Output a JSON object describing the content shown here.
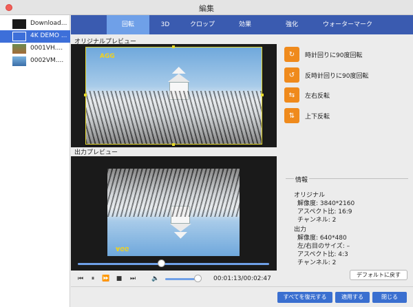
{
  "window": {
    "title": "編集"
  },
  "files": [
    {
      "name": "Download...",
      "thumb": "dark"
    },
    {
      "name": "4K DEMO ...",
      "thumb": "blue",
      "selected": true
    },
    {
      "name": "0001VH....",
      "thumb": "nature"
    },
    {
      "name": "0002VM....",
      "thumb": "sky"
    }
  ],
  "tabs": [
    "回転",
    "3D",
    "クロップ",
    "効果",
    "強化",
    "ウォーターマーク"
  ],
  "active_tab": "回転",
  "preview": {
    "original_label": "オリジナルプレビュー",
    "output_label": "出力プレビュー",
    "logo_text": "AGG"
  },
  "player": {
    "progress": 0.42,
    "volume": 0.9,
    "time": "00:01:13/00:02:47"
  },
  "actions": [
    {
      "label": "時計回りに90度回転",
      "icon": "rotate-cw-icon",
      "glyph": "↻"
    },
    {
      "label": "反時計回りに90度回転",
      "icon": "rotate-ccw-icon",
      "glyph": "↺"
    },
    {
      "label": "左右反転",
      "icon": "flip-horizontal-icon",
      "glyph": "⇆"
    },
    {
      "label": "上下反転",
      "icon": "flip-vertical-icon",
      "glyph": "⇅"
    }
  ],
  "info": {
    "title": "情報",
    "original_heading": "オリジナル",
    "original_resolution": "解像度: 3840*2160",
    "original_aspect": "アスペクト比: 16:9",
    "original_channels": "チャンネル: 2",
    "output_heading": "出力",
    "output_resolution": "解像度: 640*480",
    "output_size": "左/右目のサイズ: –",
    "output_aspect": "アスペクト比: 4:3",
    "output_channels": "チャンネル: 2"
  },
  "buttons": {
    "default": "デフォルトに戻す",
    "restore_all": "すべてを復元する",
    "apply": "適用する",
    "close": "閉じる"
  },
  "colors": {
    "accent": "#3a5bb0",
    "active_tab": "#6fa0e8",
    "action_orange": "#ef8a1c",
    "button_blue": "#3a6fd0"
  }
}
